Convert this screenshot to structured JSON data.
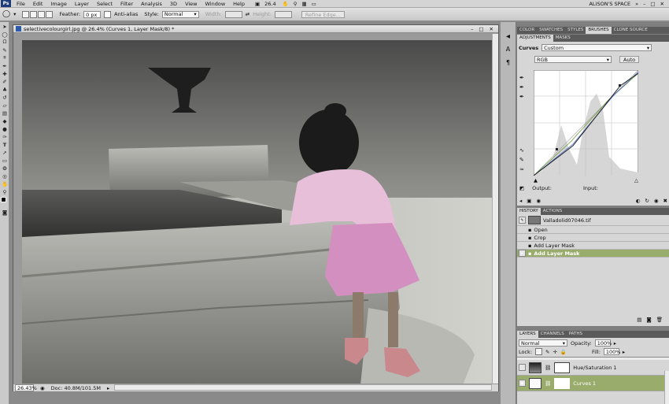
{
  "menu": {
    "items": [
      "File",
      "Edit",
      "Image",
      "Layer",
      "Select",
      "Filter",
      "Analysis",
      "3D",
      "View",
      "Window",
      "Help"
    ],
    "zoom": "26.4",
    "workspace": "ALISON'S SPACE"
  },
  "options": {
    "feather_label": "Feather:",
    "feather_value": "0 px",
    "antialias_label": "Anti-alias",
    "style_label": "Style:",
    "style_value": "Normal",
    "width_label": "Width:",
    "height_label": "Height:",
    "refine_label": "Refine Edge..."
  },
  "document": {
    "title": "selectivecolourgirl.jpg @ 26.4% (Curves 1, Layer Mask/8) *",
    "zoom": "26.43%",
    "doc_size": "Doc: 40.8M/101.5M"
  },
  "adjustments": {
    "tabs": [
      "COLOR",
      "SWATCHES",
      "STYLES",
      "BRUSHES",
      "CLONE SOURCE"
    ],
    "subtabs": [
      "ADJUSTMENTS",
      "MASKS"
    ],
    "curves_label": "Curves",
    "preset_value": "Custom",
    "channel_value": "RGB",
    "auto_label": "Auto",
    "output_label": "Output:",
    "input_label": "Input:"
  },
  "history": {
    "tabs": [
      "HISTORY",
      "ACTIONS"
    ],
    "snapshot": "Valladolid07046.tif",
    "items": [
      "Open",
      "Crop",
      "Add Layer Mask",
      "Add Layer Mask"
    ],
    "active_index": 3
  },
  "layers": {
    "tabs": [
      "LAYERS",
      "CHANNELS",
      "PATHS"
    ],
    "blend_mode": "Normal",
    "opacity_label": "Opacity:",
    "opacity_value": "100%",
    "lock_label": "Lock:",
    "fill_label": "Fill:",
    "fill_value": "100%",
    "items": [
      {
        "name": "Hue/Saturation 1",
        "active": false
      },
      {
        "name": "Curves 1",
        "active": true
      }
    ]
  },
  "colors": {
    "accent": "#9aac6c",
    "panel_bg": "#d6d6d6",
    "tab_dark": "#5a5a5a"
  }
}
